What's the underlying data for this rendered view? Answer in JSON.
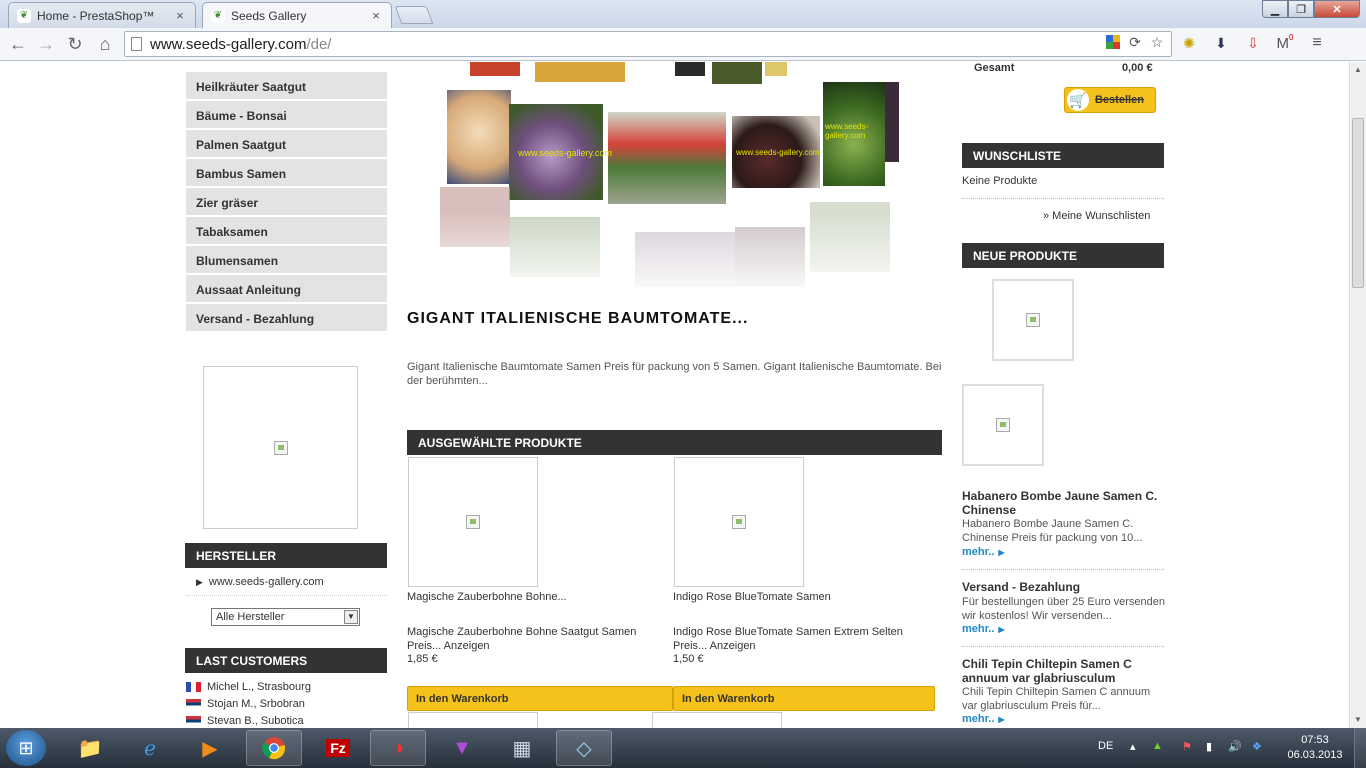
{
  "browser": {
    "tabs": [
      {
        "label": "Home - PrestaShop™",
        "close": "×"
      },
      {
        "label": "Seeds Gallery",
        "close": "×"
      }
    ],
    "url_host": "www.seeds-gallery.com",
    "url_path": "/de/",
    "gmail_count": "0"
  },
  "categories": [
    "Heilkräuter Saatgut",
    "Bäume - Bonsai",
    "Palmen Saatgut",
    "Bambus Samen",
    "Zier gräser",
    "Tabaksamen",
    "Blumensamen",
    "Aussaat Anleitung",
    "Versand - Bezahlung"
  ],
  "manufacturers": {
    "heading": "HERSTELLER",
    "link": "www.seeds-gallery.com",
    "select_value": "Alle Hersteller"
  },
  "last_customers": {
    "heading": "LAST CUSTOMERS",
    "items": [
      {
        "flag": "fr",
        "text": "Michel L., Strasbourg"
      },
      {
        "flag": "rs",
        "text": "Stojan M., Srbobran"
      },
      {
        "flag": "rs",
        "text": "Stevan B., Subotica"
      }
    ]
  },
  "product": {
    "title": "GIGANT ITALIENISCHE BAUMTOMATE...",
    "description": "Gigant Italienische Baumtomate Samen   Preis für packung von 5 Samen.   Gigant Italienische Baumtomate. Bei der berühmten..."
  },
  "featured": {
    "heading": "AUSGEWÄHLTE PRODUKTE",
    "items": [
      {
        "name": "Magische Zauberbohne Bohne...",
        "desc": "Magische Zauberbohne Bohne Saatgut Samen    Preis... Anzeigen",
        "price": "1,85 €",
        "button": "In den Warenkorb"
      },
      {
        "name": "Indigo Rose BlueTomate Samen",
        "desc": "Indigo Rose BlueTomate Samen Extrem Selten    Preis... Anzeigen",
        "price": "1,50 €",
        "button": "In den Warenkorb"
      }
    ]
  },
  "cart": {
    "total_label": "Gesamt",
    "total_value": "0,00 €",
    "order_button": "Bestellen"
  },
  "wishlist": {
    "heading": "WUNSCHLISTE",
    "empty": "Keine Produkte",
    "link": "» Meine Wunschlisten"
  },
  "new_products": {
    "heading": "NEUE PRODUKTE",
    "items": [
      {
        "title": "Habanero Bombe Jaune Samen C. Chinense",
        "desc": "Habanero Bombe Jaune Samen C. Chinense   Preis für packung von 10...",
        "more": "mehr.."
      },
      {
        "title": "Versand - Bezahlung",
        "desc": "Für bestellungen über 25 Euro versenden wir kostenlos! Wir versenden...",
        "more": "mehr.."
      },
      {
        "title": "Chili Tepin Chiltepin Samen C annuum var glabriusculum",
        "desc": "Chili Tepin Chiltepin Samen C annuum var glabriusculum   Preis für...",
        "more": "mehr.."
      }
    ]
  },
  "collage_caption": "www.seeds-gallery.com",
  "taskbar": {
    "lang": "DE",
    "time": "07:53",
    "date": "06.03.2013"
  },
  "colors": {
    "accent_yellow": "#f5c21c",
    "block_header": "#333333",
    "link_blue": "#1e88c7",
    "category_bg": "#e3e3e3"
  }
}
